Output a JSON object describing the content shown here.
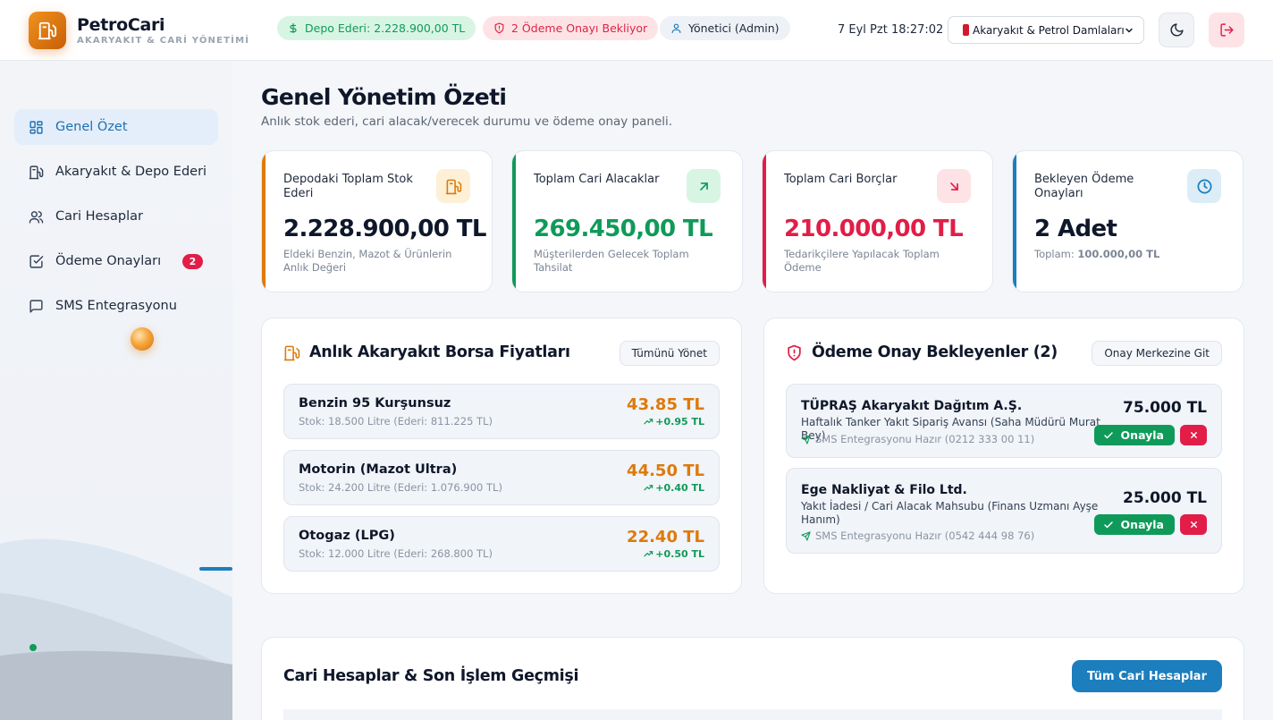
{
  "header": {
    "brand_name": "PetroCari",
    "brand_sub": "AKARYAKIT & CARİ YÖNETİMİ",
    "depot_pill": "Depo Ederi: 2.228.900,00 TL",
    "pending_pill": "2 Ödeme Onayı Bekliyor",
    "role_pill": "Yönetici (Admin)",
    "datetime": "7 Eyl Pzt 18:27:02",
    "company_select": "Akaryakıt & Petrol Damlaları"
  },
  "sidebar": {
    "items": [
      {
        "label": "Genel Özet",
        "icon": "dashboard-icon"
      },
      {
        "label": "Akaryakıt & Depo Ederi",
        "icon": "fuel-pump-icon"
      },
      {
        "label": "Cari Hesaplar",
        "icon": "users-icon"
      },
      {
        "label": "Ödeme Onayları",
        "icon": "checkbox-icon",
        "badge": "2"
      },
      {
        "label": "SMS Entegrasyonu",
        "icon": "message-icon"
      }
    ]
  },
  "page": {
    "title": "Genel Yönetim Özeti",
    "subtitle": "Anlık stok ederi, cari alacak/verecek durumu ve ödeme onay paneli."
  },
  "stats": [
    {
      "label": "Depodaki Toplam Stok Ederi",
      "value": "2.228.900,00 TL",
      "desc": "Eldeki Benzin, Mazot & Ürünlerin Anlık Değeri",
      "color": "#dd7a0c",
      "icon": "fuel-pump-icon"
    },
    {
      "label": "Toplam Cari Alacaklar",
      "value": "269.450,00 TL",
      "desc": "Müşterilerden Gelecek Toplam Tahsilat",
      "color": "#109a5a",
      "icon": "arrow-up-right-icon"
    },
    {
      "label": "Toplam Cari Borçlar",
      "value": "210.000,00 TL",
      "desc": "Tedarikçilere Yapılacak Toplam Ödeme",
      "color": "#e11d48",
      "icon": "arrow-down-right-icon"
    },
    {
      "label": "Bekleyen Ödeme Onayları",
      "value": "2 Adet",
      "desc_prefix": "Toplam:",
      "desc_value": "100.000,00 TL",
      "color": "#1c7ebd",
      "icon": "clock-icon"
    }
  ],
  "fuel_panel": {
    "title": "Anlık Akaryakıt Borsa Fiyatları",
    "manage_button": "Tümünü Yönet",
    "items": [
      {
        "name": "Benzin 95 Kurşunsuz",
        "stock": "Stok: 18.500 Litre (Ederi: 811.225 TL)",
        "price": "43.85 TL",
        "change": "+0.95 TL"
      },
      {
        "name": "Motorin (Mazot Ultra)",
        "stock": "Stok: 24.200 Litre (Ederi: 1.076.900 TL)",
        "price": "44.50 TL",
        "change": "+0.40 TL"
      },
      {
        "name": "Otogaz (LPG)",
        "stock": "Stok: 12.000 Litre (Ederi: 268.800 TL)",
        "price": "22.40 TL",
        "change": "+0.50 TL"
      }
    ]
  },
  "approval_panel": {
    "title": "Ödeme Onay Bekleyenler (2)",
    "center_button": "Onay Merkezine Git",
    "approve_label": "Onayla",
    "items": [
      {
        "company": "TÜPRAŞ Akaryakıt Dağıtım A.Ş.",
        "desc": "Haftalık Tanker Yakıt Sipariş Avansı (Saha Müdürü Murat Bey)",
        "sms": "SMS Entegrasyonu Hazır (0212 333 00 11)",
        "amount": "75.000 TL"
      },
      {
        "company": "Ege Nakliyat & Filo Ltd.",
        "desc": "Yakıt İadesi / Cari Alacak Mahsubu (Finans Uzmanı Ayşe Hanım)",
        "sms": "SMS Entegrasyonu Hazır (0542 444 98 76)",
        "amount": "25.000 TL"
      }
    ]
  },
  "accounts_section": {
    "title": "Cari Hesaplar & Son İşlem Geçmişi",
    "all_button": "Tüm Cari Hesaplar"
  }
}
